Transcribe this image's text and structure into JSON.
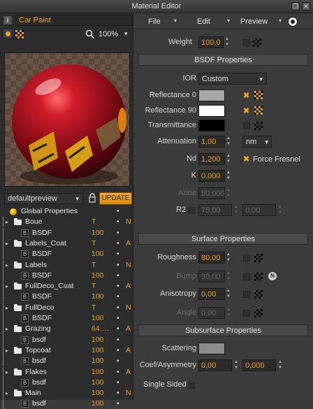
{
  "window": {
    "title": "Material Editor"
  },
  "left": {
    "material_name": "Car Paint",
    "zoom": "100%",
    "preview_scene": "defaultpreview",
    "update_label": "UPDATE",
    "tree": [
      {
        "name": "Global Properties",
        "value": "",
        "dot": "•",
        "flag": "",
        "icon": "sphere",
        "level": 0
      },
      {
        "name": "Boue",
        "value": "T",
        "dot": "•",
        "flag": "N",
        "icon": "folder",
        "level": 1
      },
      {
        "name": "BSDF",
        "value": "100",
        "dot": "•",
        "flag": "",
        "icon": "bsdf",
        "level": 2
      },
      {
        "name": "Labels_Coat",
        "value": "T",
        "dot": "•",
        "flag": "A",
        "icon": "folder",
        "level": 1
      },
      {
        "name": "BSDF",
        "value": "100",
        "dot": "•",
        "flag": "",
        "icon": "bsdf",
        "level": 2
      },
      {
        "name": "Labels",
        "value": "T",
        "dot": "•",
        "flag": "N",
        "icon": "folder",
        "level": 1
      },
      {
        "name": "BSDF",
        "value": "100",
        "dot": "•",
        "flag": "",
        "icon": "bsdf",
        "level": 2
      },
      {
        "name": "FullDeco_Coat",
        "value": "T",
        "dot": "•",
        "flag": "A",
        "icon": "folder",
        "level": 1
      },
      {
        "name": "BSDF",
        "value": "100",
        "dot": "•",
        "flag": "",
        "icon": "bsdf",
        "level": 2
      },
      {
        "name": "FullDeco",
        "value": "T",
        "dot": "•",
        "flag": "N",
        "icon": "folder",
        "level": 1
      },
      {
        "name": "BSDF",
        "value": "100",
        "dot": "•",
        "flag": "",
        "icon": "bsdf",
        "level": 2
      },
      {
        "name": "Grazing",
        "value": "64.…",
        "dot": "•",
        "flag": "A",
        "icon": "folder",
        "level": 1
      },
      {
        "name": "bsdf",
        "value": "100",
        "dot": "•",
        "flag": "",
        "icon": "bsdf",
        "level": 2
      },
      {
        "name": "Topcoat",
        "value": "100",
        "dot": "•",
        "flag": "A",
        "icon": "folder",
        "level": 1
      },
      {
        "name": "bsdf",
        "value": "100",
        "dot": "•",
        "flag": "",
        "icon": "bsdf",
        "level": 2
      },
      {
        "name": "Flakes",
        "value": "100",
        "dot": "•",
        "flag": "A",
        "icon": "folder",
        "level": 1
      },
      {
        "name": "bsdf",
        "value": "100",
        "dot": "•",
        "flag": "",
        "icon": "bsdf",
        "level": 2
      },
      {
        "name": "Main",
        "value": "100",
        "dot": "•",
        "flag": "N",
        "icon": "folder",
        "level": 1
      },
      {
        "name": "bsdf",
        "value": "100",
        "dot": "•",
        "flag": "",
        "icon": "bsdf",
        "level": 2
      }
    ]
  },
  "menu": {
    "file": "File",
    "edit": "Edit",
    "preview": "Preview"
  },
  "props": {
    "weight_label": "Weight",
    "weight": "100,0",
    "bsdf_section": "BSDF Properties",
    "ior_label": "IOR",
    "ior": "Custom",
    "refl0_label": "Reflectance 0",
    "refl90_label": "Reflectance 90",
    "trans_label": "Transmittance",
    "atten_label": "Attenuation",
    "atten": "1,00",
    "atten_unit": "nm",
    "nd_label": "Nd",
    "nd": "1,200",
    "force_fresnel": "Force Fresnel",
    "k_label": "K",
    "k": "0,000",
    "abbe_label": "Abbe",
    "abbe": "50,000",
    "r2_label": "R2",
    "r2_a": "75,00",
    "r2_b": "0,00",
    "surface_section": "Surface Properties",
    "roughness_label": "Roughness",
    "roughness": "80,00",
    "bump_label": "Bump",
    "bump": "30,00",
    "bump_badge": "N",
    "aniso_label": "Anisotropy",
    "aniso": "0,00",
    "angle_label": "Angle",
    "angle": "0,00",
    "subsurface_section": "Subsurface Properties",
    "scattering_label": "Scattering",
    "coef_label": "Coef/Asymmetry",
    "coef_a": "0,00",
    "coef_b": "0,000",
    "single_sided_label": "Single Sided"
  },
  "colors": {
    "accent": "#f0a020",
    "reflectance0": "#a8a8a8",
    "reflectance90": "#ffffff",
    "transmittance": "#000000",
    "scattering": "#8c8c8c"
  }
}
